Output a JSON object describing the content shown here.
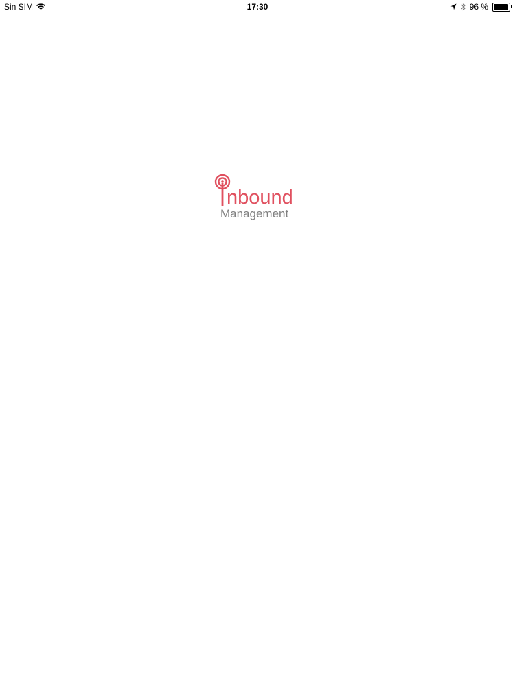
{
  "status_bar": {
    "carrier": "Sin SIM",
    "time": "17:30",
    "battery_text": "96 %",
    "battery_level": 0.96,
    "icons": [
      "wifi-icon",
      "location-icon",
      "bluetooth-icon",
      "battery-icon"
    ]
  },
  "logo": {
    "word_rest": "nbound",
    "subtitle": "Management",
    "colors": {
      "brand_red": "#e0505f",
      "subtitle_gray": "#7f7f7f"
    },
    "icon": "broadcast-antenna-icon"
  }
}
